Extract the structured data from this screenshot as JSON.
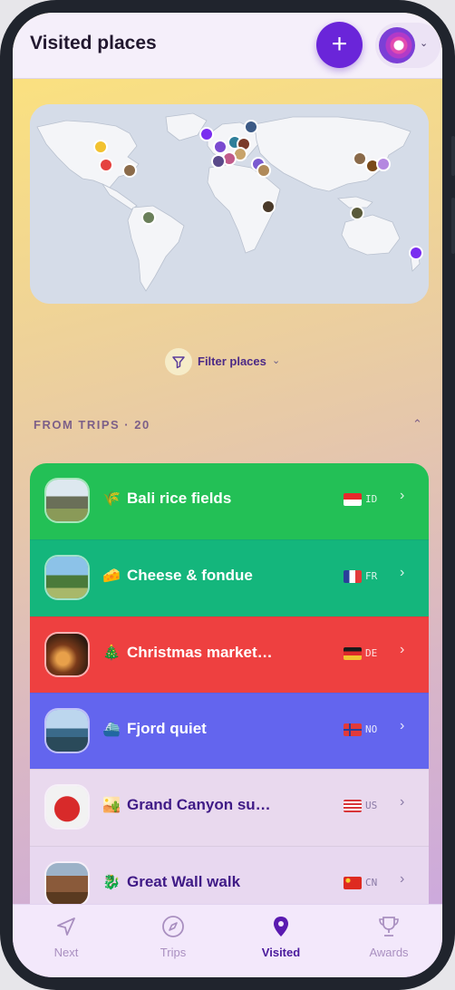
{
  "header": {
    "title": "Visited places",
    "add_label": "+"
  },
  "map": {
    "zoom_in": "+",
    "zoom_out": "−"
  },
  "filter": {
    "label": "Filter places"
  },
  "section": {
    "title": "FROM TRIPS · 20"
  },
  "places": [
    {
      "emoji": "🌾",
      "name": "Bali rice fields",
      "code": "ID",
      "bg": "#23c056",
      "text": "#ffffff"
    },
    {
      "emoji": "🧀",
      "name": "Cheese & fondue",
      "code": "FR",
      "bg": "#14b67c",
      "text": "#ffffff"
    },
    {
      "emoji": "🎄",
      "name": "Christmas market…",
      "code": "DE",
      "bg": "#ee4040",
      "text": "#ffffff"
    },
    {
      "emoji": "⛴️",
      "name": "Fjord quiet",
      "code": "NO",
      "bg": "#6365ee",
      "text": "#ffffff"
    },
    {
      "emoji": "🏜️",
      "name": "Grand Canyon su…",
      "code": "US",
      "bg": "#e9d9ee",
      "text": "#3f1a86"
    },
    {
      "emoji": "🐉",
      "name": "Great Wall walk",
      "code": "CN",
      "bg": "#e8d8f0",
      "text": "#3f1a86"
    }
  ],
  "tabs": [
    {
      "label": "Next",
      "icon": "navigation-arrow-icon"
    },
    {
      "label": "Trips",
      "icon": "compass-icon"
    },
    {
      "label": "Visited",
      "icon": "map-pin-icon"
    },
    {
      "label": "Awards",
      "icon": "trophy-icon"
    }
  ],
  "colors": {
    "accent": "#6a25d9",
    "active_tab": "#4a1a9c",
    "inactive_tab": "#a98fc0"
  }
}
